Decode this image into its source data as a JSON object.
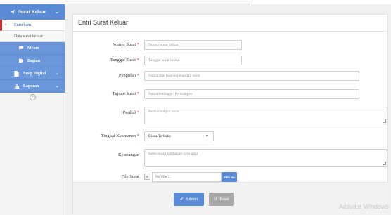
{
  "sidebar": {
    "header": "Surat Keluar",
    "sub_items": [
      {
        "label": "Entri baru"
      },
      {
        "label": "Data surat keluar"
      }
    ],
    "buttons": [
      {
        "label": "Memo"
      },
      {
        "label": "Bagian"
      },
      {
        "label": "Arsip Digital"
      },
      {
        "label": "Laporan"
      }
    ]
  },
  "panel": {
    "title": "Entri Surat Keluar"
  },
  "form": {
    "nomor": {
      "label": "Nomor Surat",
      "placeholder": "Nomor surat keluar"
    },
    "tanggal": {
      "label": "Tanggal Surat",
      "placeholder": "Tanggal surat keluar"
    },
    "pengolah": {
      "label": "Pengolah",
      "placeholder": "Nama atau bagian pengolah surat"
    },
    "tujuan": {
      "label": "Tujuan Surat",
      "placeholder": "Nama lembaga / Perorangan"
    },
    "perihal": {
      "label": "Perihal",
      "placeholder": "Perihal/subjek surat"
    },
    "tingkat": {
      "label": "Tingkat Keamanan",
      "value": "Biasa/Terbuka"
    },
    "keterangan": {
      "label": "Keterangan",
      "placeholder": "Keterangan tambahan (jika ada)"
    },
    "file": {
      "label": "File Surat",
      "value": "No File ...",
      "button": "Pilih file"
    },
    "required_mark": "*"
  },
  "actions": {
    "submit": "Submit",
    "reset": "Reset"
  },
  "watermark": "Activate Windows"
}
